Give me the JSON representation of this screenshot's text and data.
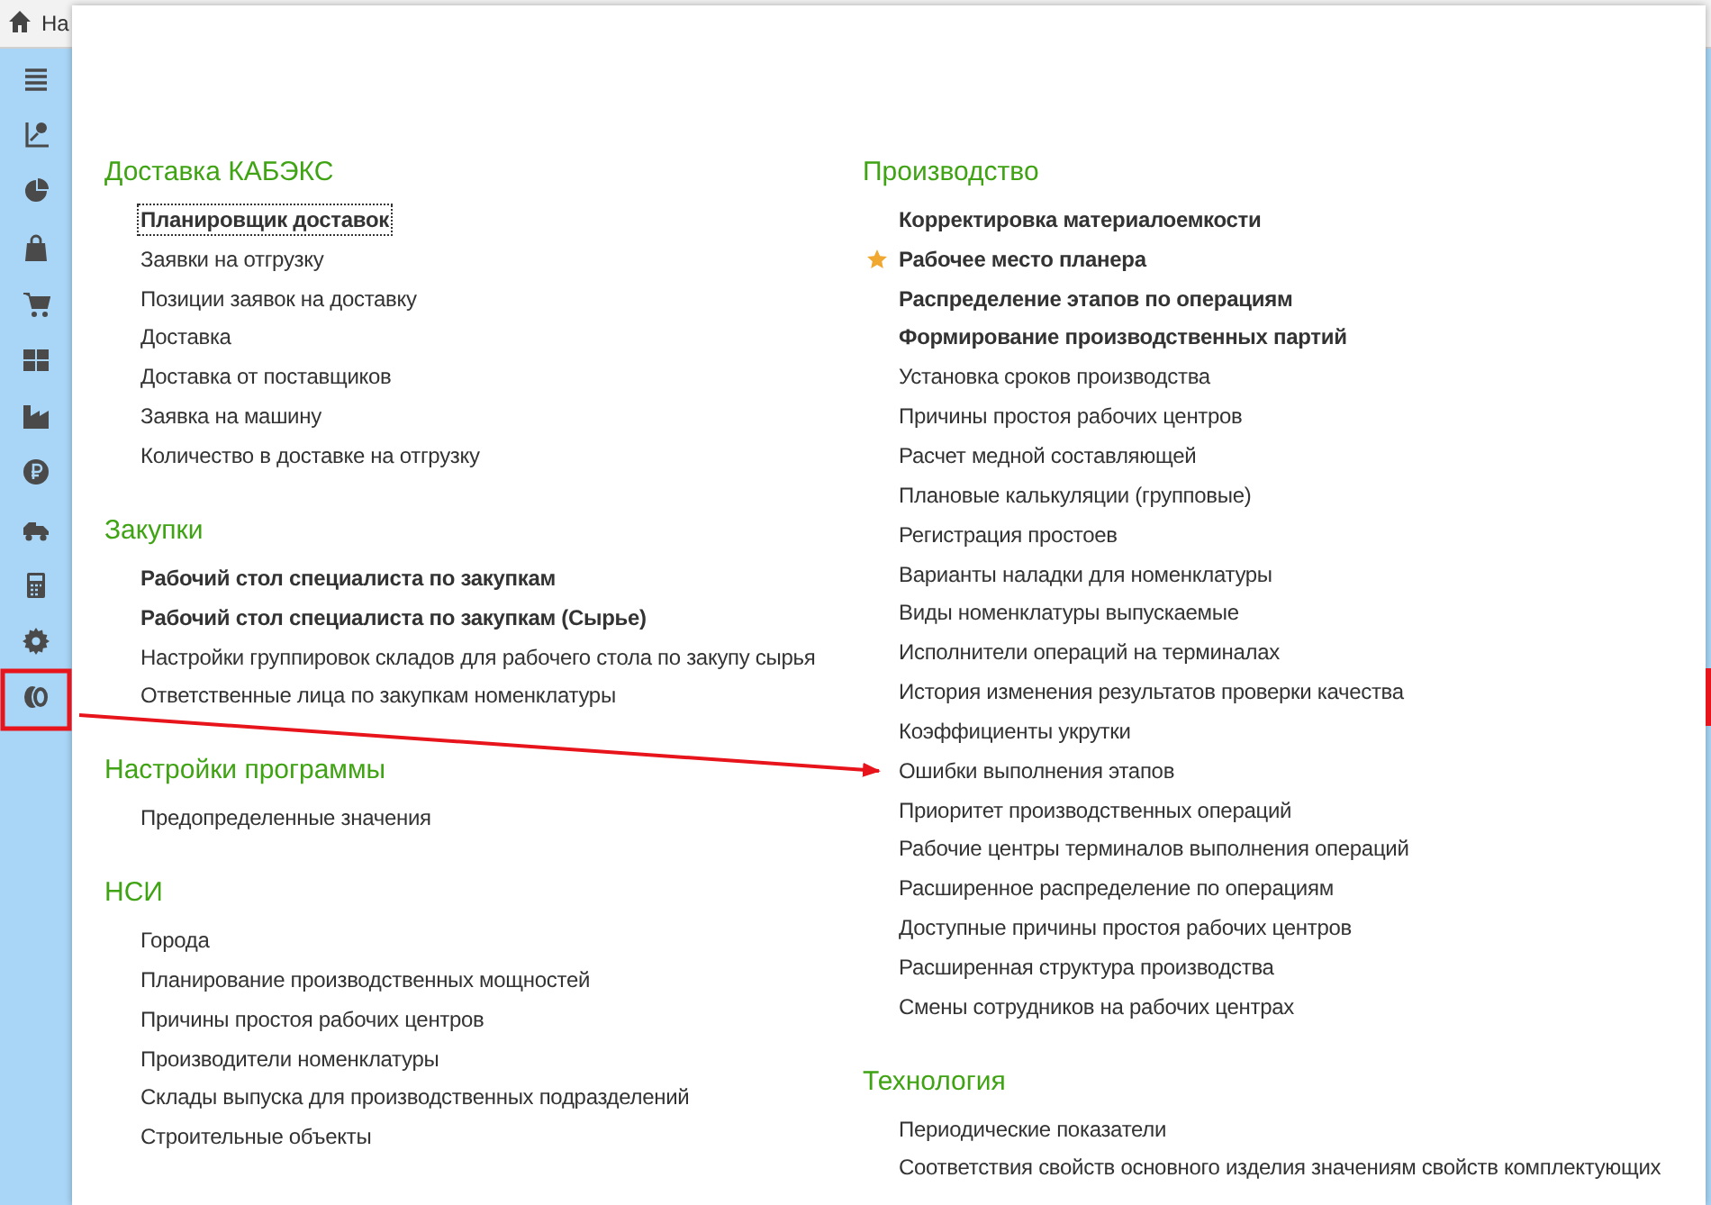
{
  "tab": {
    "label": "На"
  },
  "columns": [
    {
      "sections": [
        {
          "title": "Доставка КАБЭКС",
          "items": [
            {
              "label": "Планировщик доставок",
              "bold": true,
              "starred": false,
              "focused": true
            },
            {
              "label": "Заявки на отгрузку",
              "bold": false,
              "starred": false,
              "focused": false
            },
            {
              "label": "Позиции заявок на доставку",
              "bold": false,
              "starred": false,
              "focused": false
            },
            {
              "label": "Доставка",
              "bold": false,
              "starred": false,
              "focused": false
            },
            {
              "label": "Доставка от поставщиков",
              "bold": false,
              "starred": false,
              "focused": false
            },
            {
              "label": "Заявка на машину",
              "bold": false,
              "starred": false,
              "focused": false
            },
            {
              "label": "Количество в доставке на отгрузку",
              "bold": false,
              "starred": false,
              "focused": false
            }
          ]
        },
        {
          "title": "Закупки",
          "items": [
            {
              "label": "Рабочий стол специалиста по закупкам",
              "bold": true,
              "starred": false,
              "focused": false
            },
            {
              "label": "Рабочий стол специалиста по закупкам (Сырье)",
              "bold": true,
              "starred": false,
              "focused": false
            },
            {
              "label": "Настройки группировок складов для рабочего стола по закупу сырья",
              "bold": false,
              "starred": false,
              "focused": false
            },
            {
              "label": "Ответственные лица по закупкам номенклатуры",
              "bold": false,
              "starred": false,
              "focused": false
            }
          ]
        },
        {
          "title": "Настройки программы",
          "items": [
            {
              "label": "Предопределенные значения",
              "bold": false,
              "starred": false,
              "focused": false
            }
          ]
        },
        {
          "title": "НСИ",
          "items": [
            {
              "label": "Города",
              "bold": false,
              "starred": false,
              "focused": false
            },
            {
              "label": "Планирование производственных мощностей",
              "bold": false,
              "starred": false,
              "focused": false
            },
            {
              "label": "Причины простоя рабочих центров",
              "bold": false,
              "starred": false,
              "focused": false
            },
            {
              "label": "Производители номенклатуры",
              "bold": false,
              "starred": false,
              "focused": false
            },
            {
              "label": "Склады выпуска для производственных подразделений",
              "bold": false,
              "starred": false,
              "focused": false
            },
            {
              "label": "Строительные объекты",
              "bold": false,
              "starred": false,
              "focused": false
            }
          ]
        }
      ]
    },
    {
      "sections": [
        {
          "title": "Производство",
          "items": [
            {
              "label": "Корректировка материалоемкости",
              "bold": true,
              "starred": false,
              "focused": false
            },
            {
              "label": "Рабочее место планера",
              "bold": true,
              "starred": true,
              "focused": false
            },
            {
              "label": "Распределение этапов по операциям",
              "bold": true,
              "starred": false,
              "focused": false
            },
            {
              "label": "Формирование производственных партий",
              "bold": true,
              "starred": false,
              "focused": false
            },
            {
              "label": "Установка сроков производства",
              "bold": false,
              "starred": false,
              "focused": false
            },
            {
              "label": "Причины простоя рабочих центров",
              "bold": false,
              "starred": false,
              "focused": false
            },
            {
              "label": "Расчет медной составляющей",
              "bold": false,
              "starred": false,
              "focused": false
            },
            {
              "label": "Плановые калькуляции (групповые)",
              "bold": false,
              "starred": false,
              "focused": false
            },
            {
              "label": "Регистрация простоев",
              "bold": false,
              "starred": false,
              "focused": false
            },
            {
              "label": "Варианты наладки для номенклатуры",
              "bold": false,
              "starred": false,
              "focused": false
            },
            {
              "label": "Виды номенклатуры выпускаемые",
              "bold": false,
              "starred": false,
              "focused": false
            },
            {
              "label": "Исполнители операций на терминалах",
              "bold": false,
              "starred": false,
              "focused": false
            },
            {
              "label": "История изменения результатов проверки качества",
              "bold": false,
              "starred": false,
              "focused": false
            },
            {
              "label": "Коэффициенты укрутки",
              "bold": false,
              "starred": false,
              "focused": false
            },
            {
              "label": "Ошибки выполнения этапов",
              "bold": false,
              "starred": false,
              "focused": false
            },
            {
              "label": "Приоритет производственных операций",
              "bold": false,
              "starred": false,
              "focused": false
            },
            {
              "label": "Рабочие центры терминалов выполнения операций",
              "bold": false,
              "starred": false,
              "focused": false
            },
            {
              "label": "Расширенное распределение по операциям",
              "bold": false,
              "starred": false,
              "focused": false
            },
            {
              "label": "Доступные причины простоя рабочих центров",
              "bold": false,
              "starred": false,
              "focused": false
            },
            {
              "label": "Расширенная структура производства",
              "bold": false,
              "starred": false,
              "focused": false
            },
            {
              "label": "Смены сотрудников на рабочих центрах",
              "bold": false,
              "starred": false,
              "focused": false
            }
          ]
        },
        {
          "title": "Технология",
          "items": [
            {
              "label": "Периодические показатели",
              "bold": false,
              "starred": false,
              "focused": false
            },
            {
              "label": "Соответствия свойств основного изделия значениям свойств комплектующих",
              "bold": false,
              "starred": false,
              "focused": false
            }
          ]
        }
      ]
    }
  ]
}
